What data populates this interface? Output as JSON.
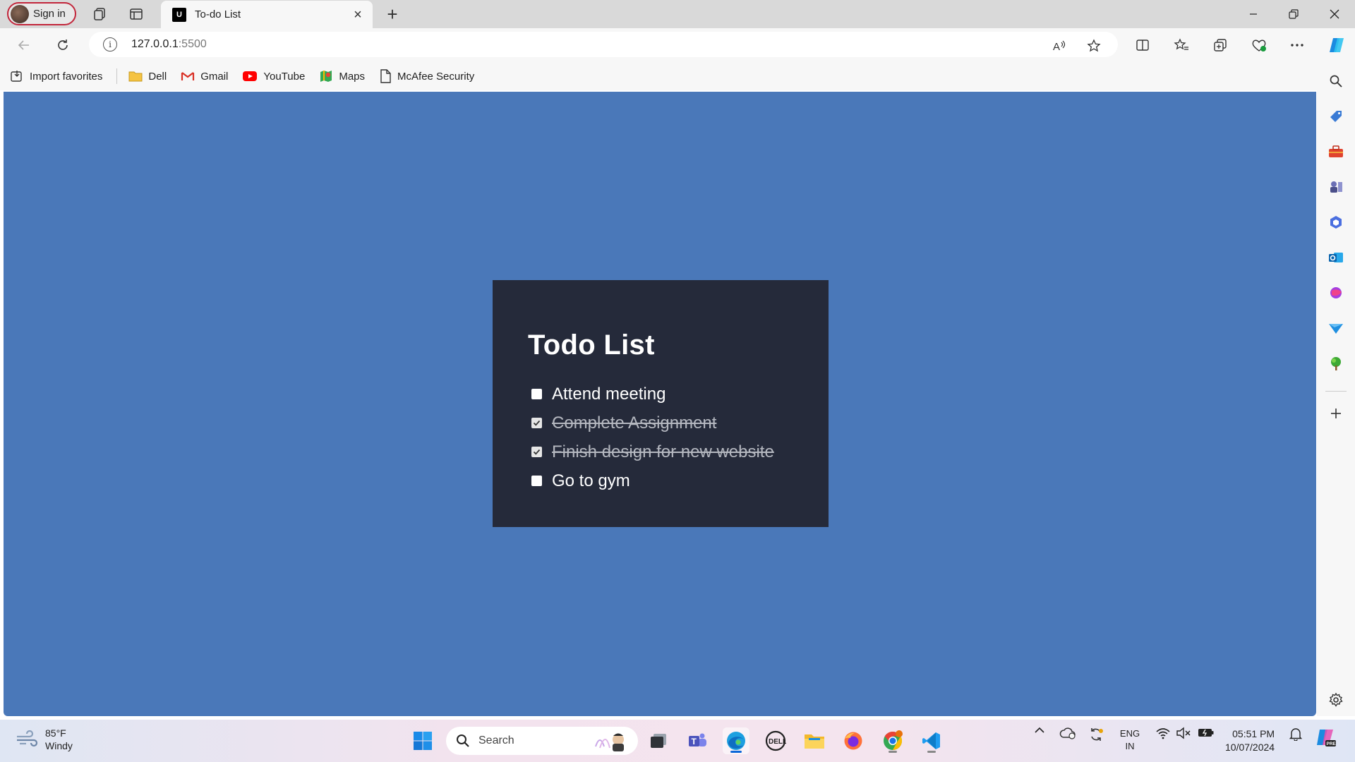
{
  "browser": {
    "signin_label": "Sign in",
    "tab_title": "To-do List",
    "tab_favicon": "U",
    "url_host": "127.0.0.1",
    "url_port": ":5500"
  },
  "favorites": [
    {
      "label": "Import favorites",
      "icon": "import-icon"
    },
    {
      "label": "Dell",
      "icon": "folder-icon"
    },
    {
      "label": "Gmail",
      "icon": "gmail-icon"
    },
    {
      "label": "YouTube",
      "icon": "youtube-icon"
    },
    {
      "label": "Maps",
      "icon": "maps-icon"
    },
    {
      "label": "McAfee Security",
      "icon": "page-icon"
    }
  ],
  "todo": {
    "title": "Todo List",
    "items": [
      {
        "text": "Attend meeting",
        "done": false
      },
      {
        "text": "Complete Assignment",
        "done": true
      },
      {
        "text": "Finish design for new website",
        "done": true
      },
      {
        "text": "Go to gym",
        "done": false
      }
    ]
  },
  "taskbar": {
    "weather_temp": "85°F",
    "weather_desc": "Windy",
    "search_placeholder": "Search",
    "lang_top": "ENG",
    "lang_bottom": "IN",
    "time": "05:51 PM",
    "date": "10/07/2024"
  },
  "colors": {
    "page_bg": "#4a78b9",
    "card_bg": "#252a3a",
    "accent": "#0b66d8"
  }
}
